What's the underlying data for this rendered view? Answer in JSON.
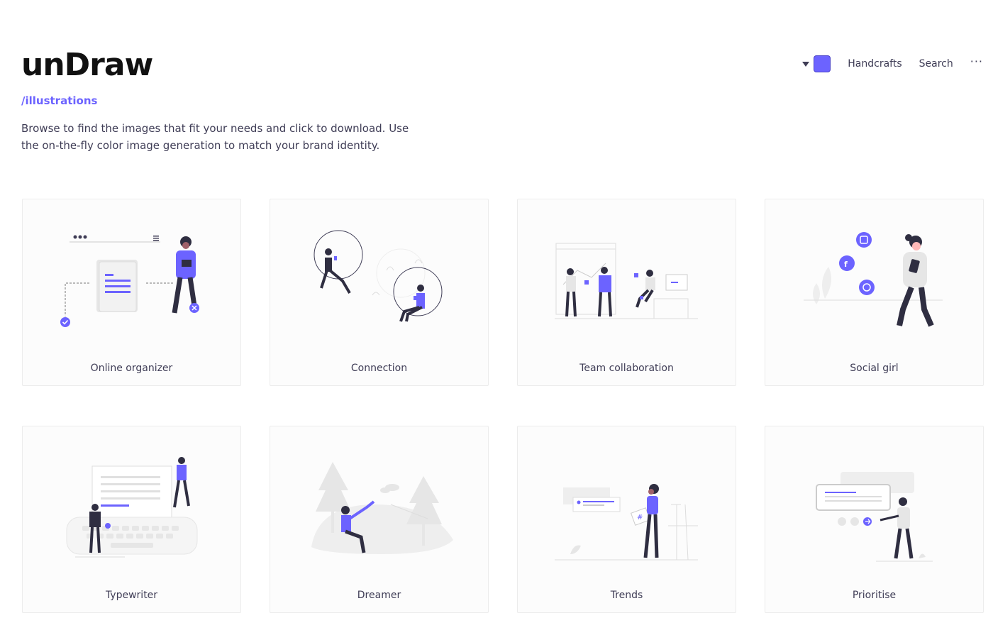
{
  "brand": {
    "logo": "unDraw",
    "section": "/illustrations"
  },
  "intro": "Browse to find the images that fit your needs and click to download. Use the on-the-fly color image generation to match your brand identity.",
  "nav": {
    "accent_color": "#6c63ff",
    "links": [
      "Handcrafts",
      "Search"
    ],
    "more": "···"
  },
  "illustrations": [
    {
      "title": "Online organizer"
    },
    {
      "title": "Connection"
    },
    {
      "title": "Team collaboration"
    },
    {
      "title": "Social girl"
    },
    {
      "title": "Typewriter"
    },
    {
      "title": "Dreamer"
    },
    {
      "title": "Trends"
    },
    {
      "title": "Prioritise"
    }
  ]
}
